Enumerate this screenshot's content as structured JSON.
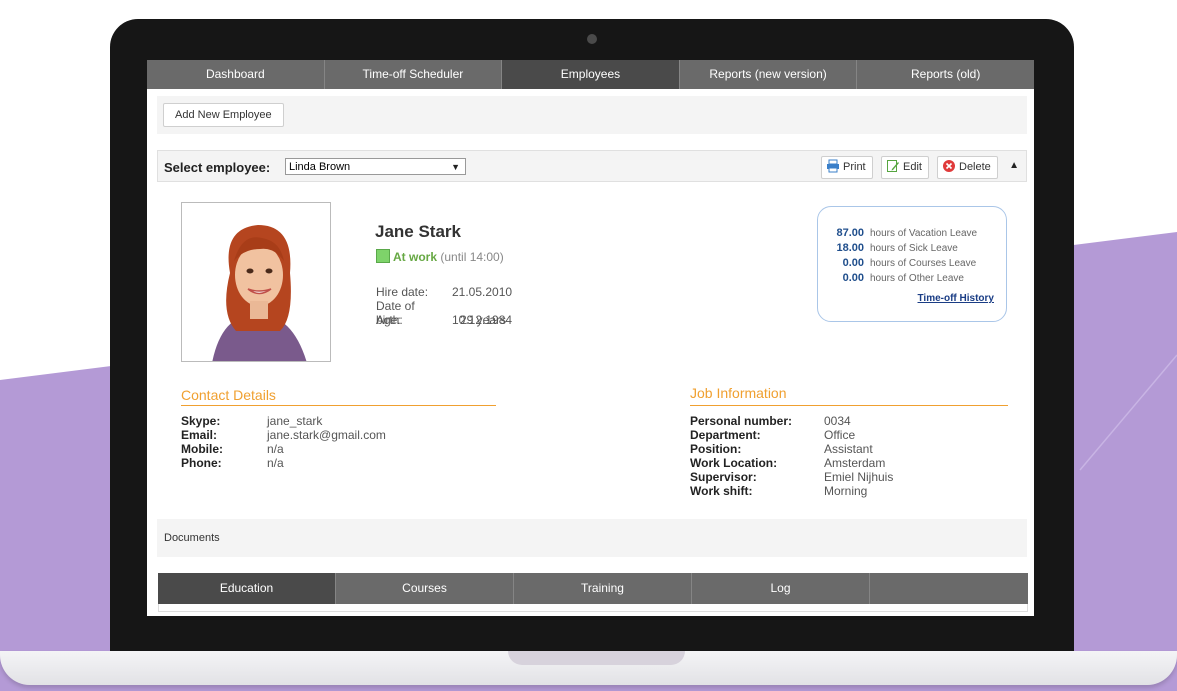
{
  "nav": {
    "tabs": [
      {
        "label": "Dashboard"
      },
      {
        "label": "Time-off Scheduler"
      },
      {
        "label": "Employees"
      },
      {
        "label": "Reports (new version)"
      },
      {
        "label": "Reports (old)"
      }
    ],
    "active_index": 2
  },
  "toolbar": {
    "add_employee_label": "Add New Employee",
    "select_label": "Select employee:",
    "selected_employee": "Linda Brown",
    "print_label": "Print",
    "edit_label": "Edit",
    "delete_label": "Delete"
  },
  "employee": {
    "name": "Jane Stark",
    "status": "At work",
    "status_detail": "(until 14:00)",
    "fields": [
      {
        "label": "Hire date:",
        "value": "21.05.2010"
      },
      {
        "label": "Date of birth:",
        "value": "10.12.1984"
      },
      {
        "label": "Age:",
        "value": "29 years"
      }
    ]
  },
  "leave": {
    "rows": [
      {
        "value": "87.00",
        "label": "hours of Vacation Leave"
      },
      {
        "value": "18.00",
        "label": "hours of Sick Leave"
      },
      {
        "value": "0.00",
        "label": "hours of Courses Leave"
      },
      {
        "value": "0.00",
        "label": "hours of Other Leave"
      }
    ],
    "history_link": "Time-off History"
  },
  "contact": {
    "title": "Contact Details",
    "rows": [
      {
        "label": "Skype:",
        "value": "jane_stark"
      },
      {
        "label": "Email:",
        "value": "jane.stark@gmail.com"
      },
      {
        "label": "Mobile:",
        "value": "n/a"
      },
      {
        "label": "Phone:",
        "value": "n/a"
      }
    ]
  },
  "job": {
    "title": "Job Information",
    "rows": [
      {
        "label": "Personal number:",
        "value": "0034"
      },
      {
        "label": "Department:",
        "value": "Office"
      },
      {
        "label": "Position:",
        "value": "Assistant"
      },
      {
        "label": "Work Location:",
        "value": "Amsterdam"
      },
      {
        "label": "Supervisor:",
        "value": "Emiel Nijhuis"
      },
      {
        "label": "Work shift:",
        "value": "Morning"
      }
    ]
  },
  "documents_label": "Documents",
  "bottom_tabs": [
    {
      "label": "Education"
    },
    {
      "label": "Courses"
    },
    {
      "label": "Training"
    },
    {
      "label": "Log"
    }
  ],
  "colors": {
    "accent_orange": "#f0a030",
    "nav_gray": "#6a6a6a",
    "nav_active": "#4a4a4a",
    "status_green": "#7ed36a",
    "leave_blue": "#1f4e8c",
    "background_purple": "#b49ad6"
  },
  "icons": [
    "printer-icon",
    "edit-icon",
    "delete-icon",
    "chevron-up-icon",
    "dropdown-arrow-icon"
  ]
}
